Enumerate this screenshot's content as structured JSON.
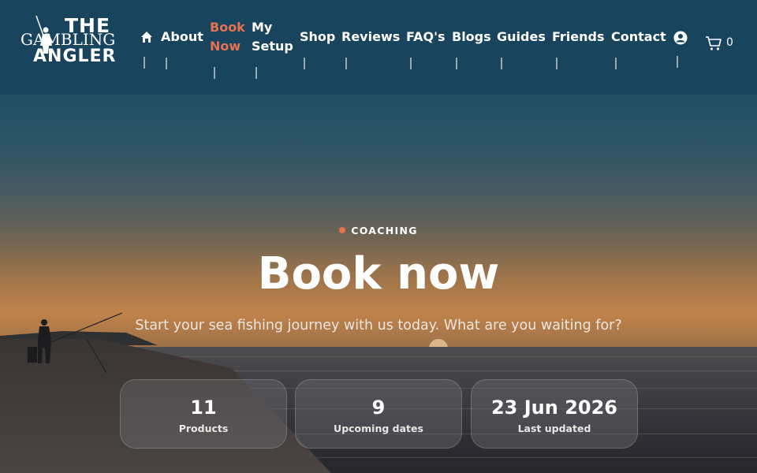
{
  "brand": {
    "line1": "THE",
    "line2": "GAMBLING",
    "line3": "ANGLER"
  },
  "nav": {
    "home_icon": "home-icon",
    "items": [
      {
        "label": "About"
      },
      {
        "label_1": "Book",
        "label_2": "Now",
        "active": true
      },
      {
        "label_1": "My",
        "label_2": "Setup"
      },
      {
        "label": "Shop"
      },
      {
        "label": "Reviews"
      },
      {
        "label": "FAQ's"
      },
      {
        "label": "Blogs"
      },
      {
        "label": "Guides"
      },
      {
        "label": "Friends"
      },
      {
        "label": "Contact"
      }
    ],
    "account_icon": "user-circle-icon",
    "cart_icon": "cart-icon",
    "cart_count": "0"
  },
  "hero": {
    "eyebrow": "COACHING",
    "title": "Book now",
    "subtitle": "Start your sea fishing journey with us today. What are you waiting for?"
  },
  "stats": [
    {
      "value": "11",
      "label": "Products"
    },
    {
      "value": "9",
      "label": "Upcoming dates"
    },
    {
      "value": "23 Jun 2026",
      "label": "Last updated"
    }
  ],
  "colors": {
    "header": "#19445e",
    "accent": "#e8714f",
    "text": "#ffffff"
  }
}
